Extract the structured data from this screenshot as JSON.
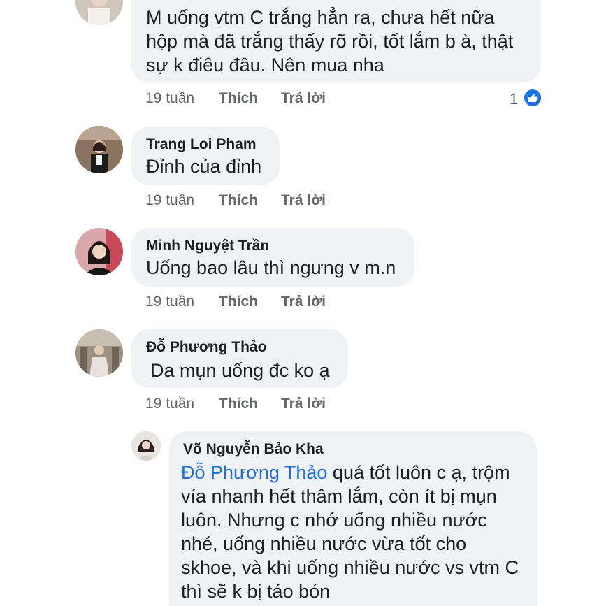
{
  "comments": [
    {
      "author": "",
      "lines": [
        "M uống vtm C trắng hẳn ra, chưa hết nữa",
        "hộp mà đã trắng thấy rõ rồi, tốt lắm b à, thật",
        "sự k điêu đâu. Nên mua nha"
      ],
      "time": "19 tuần",
      "like_label": "Thích",
      "reply_label": "Trả lời",
      "reaction_count": "1",
      "reaction_icon": "like-icon"
    },
    {
      "author": "Trang Loi Pham",
      "lines": [
        "Đỉnh của đỉnh"
      ],
      "time": "19 tuần",
      "like_label": "Thích",
      "reply_label": "Trả lời"
    },
    {
      "author": "Minh Nguyệt Trần",
      "lines": [
        "Uống bao lâu thì ngưng v m.n"
      ],
      "time": "19 tuần",
      "like_label": "Thích",
      "reply_label": "Trả lời"
    },
    {
      "author": "Đỗ Phương Thảo",
      "lines": [
        "Da mụn uống đc ko ạ"
      ],
      "time": "19 tuần",
      "like_label": "Thích",
      "reply_label": "Trả lời"
    }
  ],
  "reply": {
    "author": "Võ Nguyễn Bảo Kha",
    "mention": "Đỗ Phương Thảo",
    "first_line_rest": " quá tốt luôn c ạ, trộm",
    "lines": [
      "vía nhanh hết thâm lắm, còn ít bị mụn",
      "luôn. Nhưng c nhớ uống nhiều nước",
      "nhé, uống nhiều nước vừa tốt cho",
      "skhoe, và khi uống nhiều nước vs vtm C",
      "thì sẽ k bị táo bón"
    ]
  },
  "colors": {
    "bubble": "#eff1f4",
    "meta_text": "#65676b",
    "mention": "#216fdb",
    "like_blue": "#1b74e4"
  }
}
